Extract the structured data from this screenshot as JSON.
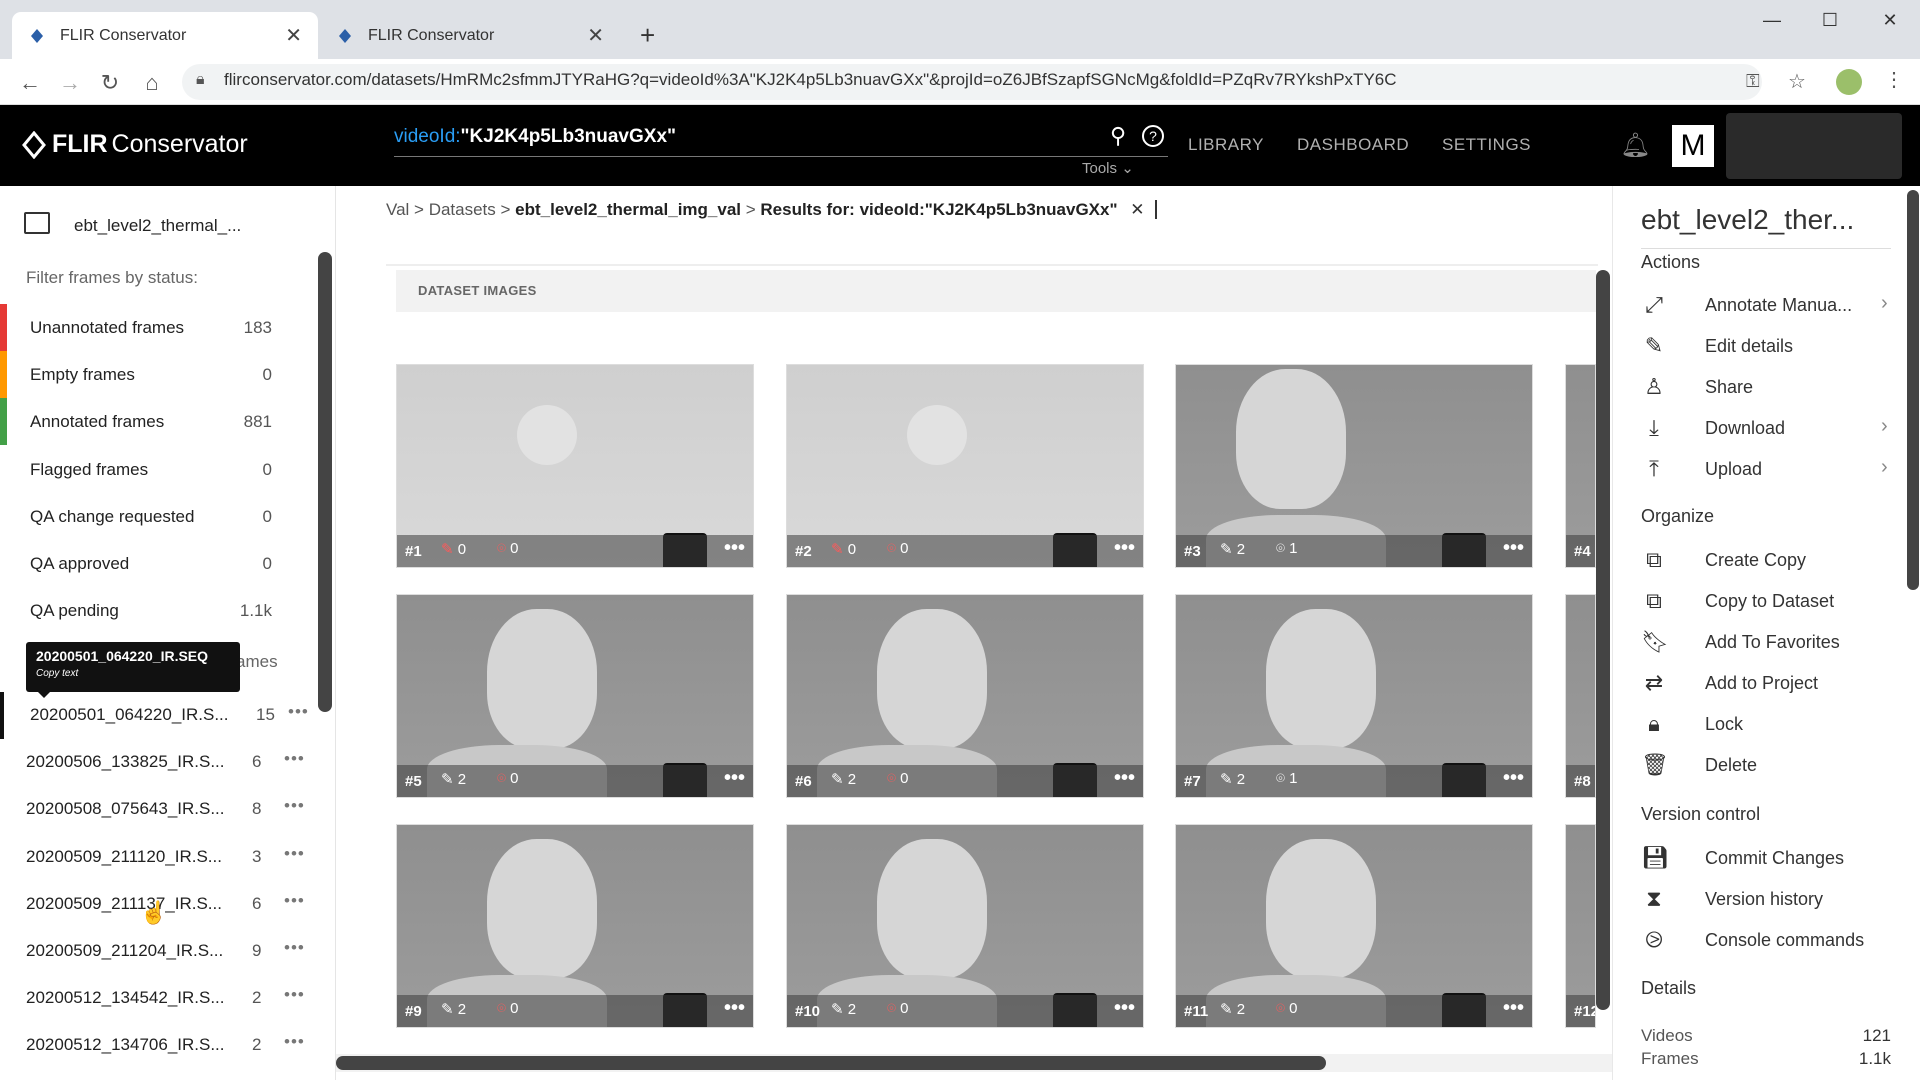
{
  "browser": {
    "tabs": [
      {
        "title": "FLIR Conservator",
        "active": true
      },
      {
        "title": "FLIR Conservator",
        "active": false
      }
    ],
    "url": "flirconservator.com/datasets/HmRMc2sfmmJTYRaHG?q=videoId%3A\"KJ2K4p5Lb3nuavGXx\"&projId=oZ6JBfSzapfSGNcMg&foldId=PZqRv7RYkshPxTY6C"
  },
  "header": {
    "logo_flir": "FLIR",
    "logo_cons": "Conservator",
    "search_key": "videoId:",
    "search_value": "\"KJ2K4p5Lb3nuavGXx\"",
    "tools": "Tools",
    "nav": [
      "LIBRARY",
      "DASHBOARD",
      "SETTINGS"
    ],
    "avatar_letter": "M"
  },
  "sidebar": {
    "dataset_name": "ebt_level2_thermal_...",
    "filter_label": "Filter frames by status:",
    "statuses": [
      {
        "label": "Unannotated frames",
        "count": "183",
        "color": "#e53935"
      },
      {
        "label": "Empty frames",
        "count": "0",
        "color": "#ff9800"
      },
      {
        "label": "Annotated frames",
        "count": "881",
        "color": "#43a047"
      },
      {
        "label": "Flagged frames",
        "count": "0",
        "color": ""
      },
      {
        "label": "QA change requested",
        "count": "0",
        "color": ""
      },
      {
        "label": "QA approved",
        "count": "0",
        "color": ""
      },
      {
        "label": "QA pending",
        "count": "1.1k",
        "color": ""
      }
    ],
    "tooltip_title": "20200501_064220_IR.SEQ",
    "tooltip_sub": "Copy text",
    "hidden_label_tail": "ames",
    "videos": [
      {
        "name": "20200501_064220_IR.S...",
        "count": "15"
      },
      {
        "name": "20200506_133825_IR.S...",
        "count": "6"
      },
      {
        "name": "20200508_075643_IR.S...",
        "count": "8"
      },
      {
        "name": "20200509_211120_IR.S...",
        "count": "3"
      },
      {
        "name": "20200509_211137_IR.S...",
        "count": "6"
      },
      {
        "name": "20200509_211204_IR.S...",
        "count": "9"
      },
      {
        "name": "20200512_134542_IR.S...",
        "count": "2"
      },
      {
        "name": "20200512_134706_IR.S...",
        "count": "2"
      }
    ]
  },
  "main": {
    "breadcrumb": [
      "Val",
      "Datasets",
      "ebt_level2_thermal_img_val",
      "Results for: videoId:\"KJ2K4p5Lb3nuavGXx\""
    ],
    "section_title": "DATASET IMAGES",
    "frames": [
      {
        "num": "#1",
        "a": "0",
        "b": "0",
        "face": false
      },
      {
        "num": "#2",
        "a": "0",
        "b": "0",
        "face": false
      },
      {
        "num": "#3",
        "a": "2",
        "b": "1",
        "face": true
      },
      {
        "num": "#4"
      },
      {
        "num": "#5",
        "a": "2",
        "b": "0",
        "face": true
      },
      {
        "num": "#6",
        "a": "2",
        "b": "0",
        "face": true
      },
      {
        "num": "#7",
        "a": "2",
        "b": "1",
        "face": true
      },
      {
        "num": "#8"
      },
      {
        "num": "#9",
        "a": "2",
        "b": "0",
        "face": true
      },
      {
        "num": "#10",
        "a": "2",
        "b": "0",
        "face": true
      },
      {
        "num": "#11",
        "a": "2",
        "b": "0",
        "face": true
      },
      {
        "num": "#12"
      }
    ]
  },
  "rpanel": {
    "title": "ebt_level2_ther...",
    "actions_title": "Actions",
    "actions": [
      {
        "label": "Annotate Manua...",
        "icon": "annotate-icon",
        "chev": true
      },
      {
        "label": "Edit details",
        "icon": "pencil-icon",
        "chev": false
      },
      {
        "label": "Share",
        "icon": "share-icon",
        "chev": false
      },
      {
        "label": "Download",
        "icon": "download-icon",
        "chev": true
      },
      {
        "label": "Upload",
        "icon": "upload-icon",
        "chev": true
      }
    ],
    "organize_title": "Organize",
    "organize": [
      {
        "label": "Create Copy",
        "icon": "copy-icon"
      },
      {
        "label": "Copy to Dataset",
        "icon": "copy-icon"
      },
      {
        "label": "Add To Favorites",
        "icon": "bookmark-icon"
      },
      {
        "label": "Add to Project",
        "icon": "transfer-icon"
      },
      {
        "label": "Lock",
        "icon": "lock-icon"
      },
      {
        "label": "Delete",
        "icon": "trash-icon"
      }
    ],
    "version_title": "Version control",
    "version": [
      {
        "label": "Commit Changes",
        "icon": "save-icon"
      },
      {
        "label": "Version history",
        "icon": "hourglass-icon"
      },
      {
        "label": "Console commands",
        "icon": "terminal-icon"
      }
    ],
    "details_title": "Details",
    "details": [
      {
        "label": "Videos",
        "value": "121"
      },
      {
        "label": "Frames",
        "value": "1.1k"
      }
    ]
  }
}
